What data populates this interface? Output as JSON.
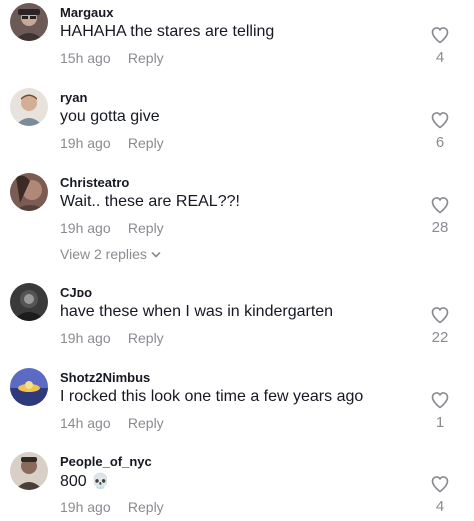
{
  "comments": [
    {
      "username": "Margaux",
      "text": "HAHAHA the stares are telling",
      "time": "15h ago",
      "reply_label": "Reply",
      "likes": "4",
      "avatar_color": "#5a4a4a"
    },
    {
      "username": "ryan",
      "text": "you gotta give",
      "time": "19h ago",
      "reply_label": "Reply",
      "likes": "6",
      "avatar_color": "#c9a990"
    },
    {
      "username": "Christeatro",
      "text": "Wait.. these are REAL??!",
      "time": "19h ago",
      "reply_label": "Reply",
      "likes": "28",
      "view_replies": "View 2 replies",
      "avatar_color": "#8c6e62"
    },
    {
      "username": "CJᴅo",
      "text": "have these when I was in kindergarten",
      "time": "19h ago",
      "reply_label": "Reply",
      "likes": "22",
      "avatar_color": "#2e2e2e"
    },
    {
      "username": "Shotz2Nimbus",
      "text": "I rocked this look one time a few years ago",
      "time": "14h ago",
      "reply_label": "Reply",
      "likes": "1",
      "avatar_color": "#4a5aa8"
    },
    {
      "username": "People_of_nyc",
      "text": "800",
      "emoji": "💀",
      "time": "19h ago",
      "reply_label": "Reply",
      "likes": "4",
      "avatar_color": "#a99b8e"
    }
  ],
  "colors": {
    "text": "#161823",
    "secondary": "#8a8b91",
    "heart_stroke": "#8a8b91"
  },
  "icons": {
    "like": "heart-outline-icon",
    "expand": "chevron-down-icon"
  }
}
